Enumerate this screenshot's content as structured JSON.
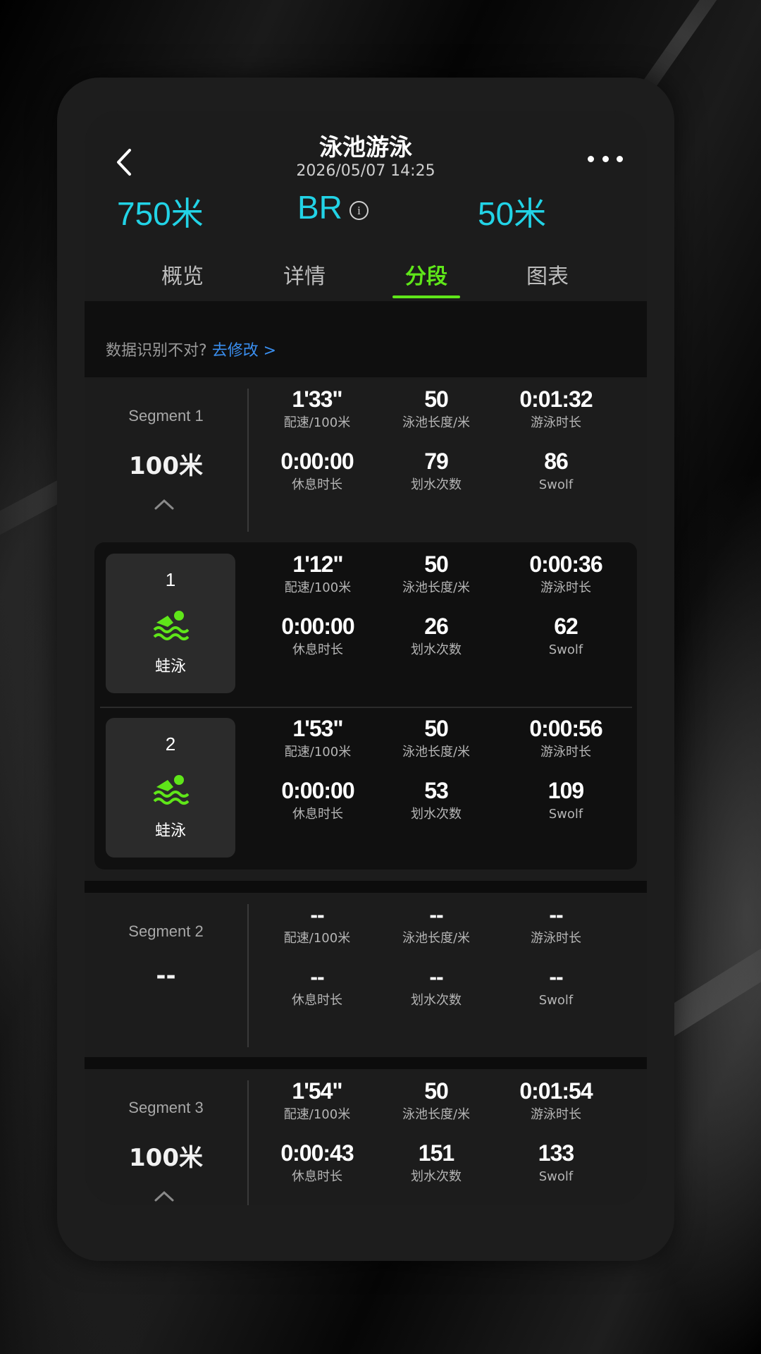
{
  "header": {
    "title": "泳池游泳",
    "datetime": "2026/05/07 14:25",
    "total_distance": "750米",
    "stroke_abbr": "BR",
    "pool_length": "50米",
    "info_glyph": "i"
  },
  "tabs": [
    "概览",
    "详情",
    "分段",
    "图表"
  ],
  "active_tab": "分段",
  "notice": {
    "text": "数据识别不对?",
    "link": "去修改 >"
  },
  "labels": {
    "pace": "配速/100米",
    "pool": "泳池长度/米",
    "time": "游泳时长",
    "rest": "休息时长",
    "strokes": "划水次数",
    "swolf": "Swolf"
  },
  "segments": [
    {
      "name": "Segment 1",
      "distance": "100米",
      "pace": "1'33\"",
      "pool": "50",
      "time": "0:01:32",
      "rest": "0:00:00",
      "strokes": "79",
      "swolf": "86"
    },
    {
      "name": "Segment 2",
      "distance": "--",
      "pace": "--",
      "pool": "--",
      "time": "--",
      "rest": "--",
      "strokes": "--",
      "swolf": "--"
    },
    {
      "name": "Segment 3",
      "distance": "100米",
      "pace": "1'54\"",
      "pool": "50",
      "time": "0:01:54",
      "rest": "0:00:43",
      "strokes": "151",
      "swolf": "133"
    }
  ],
  "laps": [
    {
      "num": "1",
      "stroke": "蛙泳",
      "pace": "1'12\"",
      "pool": "50",
      "time": "0:00:36",
      "rest": "0:00:00",
      "strokes": "26",
      "swolf": "62"
    },
    {
      "num": "2",
      "stroke": "蛙泳",
      "pace": "1'53\"",
      "pool": "50",
      "time": "0:00:56",
      "rest": "0:00:00",
      "strokes": "53",
      "swolf": "109"
    }
  ],
  "colors": {
    "accent_green": "#5fe619",
    "stat_cyan": "#22d3e6",
    "link_blue": "#3a8ff0"
  },
  "icons": {
    "back": "chevron-left-icon",
    "more": "more-dots-icon",
    "info": "info-icon",
    "swim": "swimmer-icon",
    "expand": "chevron-up-icon"
  }
}
